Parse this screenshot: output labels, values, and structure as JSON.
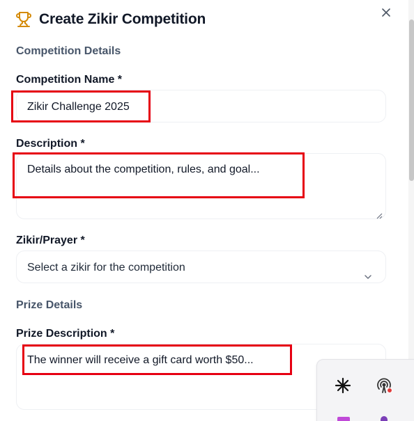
{
  "dialog": {
    "title": "Create Zikir Competition",
    "icons": {
      "title_icon": "trophy-icon",
      "close_icon": "close-icon"
    }
  },
  "sections": {
    "competition_details": "Competition Details",
    "prize_details": "Prize Details"
  },
  "fields": {
    "competition_name": {
      "label": "Competition Name *",
      "placeholder": "Zikir Challenge 2025"
    },
    "description": {
      "label": "Description *",
      "placeholder": "Details about the competition, rules, and goal..."
    },
    "zikir": {
      "label": "Zikir/Prayer *",
      "selected": "Select a zikir for the competition"
    },
    "prize_description": {
      "label": "Prize Description *",
      "placeholder": "The winner will receive a gift card worth $50..."
    }
  },
  "floating_toolbar": {
    "icons": [
      "sparkle-icon",
      "broadcast-icon"
    ]
  },
  "colors": {
    "highlight": "#e60012",
    "trophy": "#d48a07",
    "section_title": "#475569"
  }
}
